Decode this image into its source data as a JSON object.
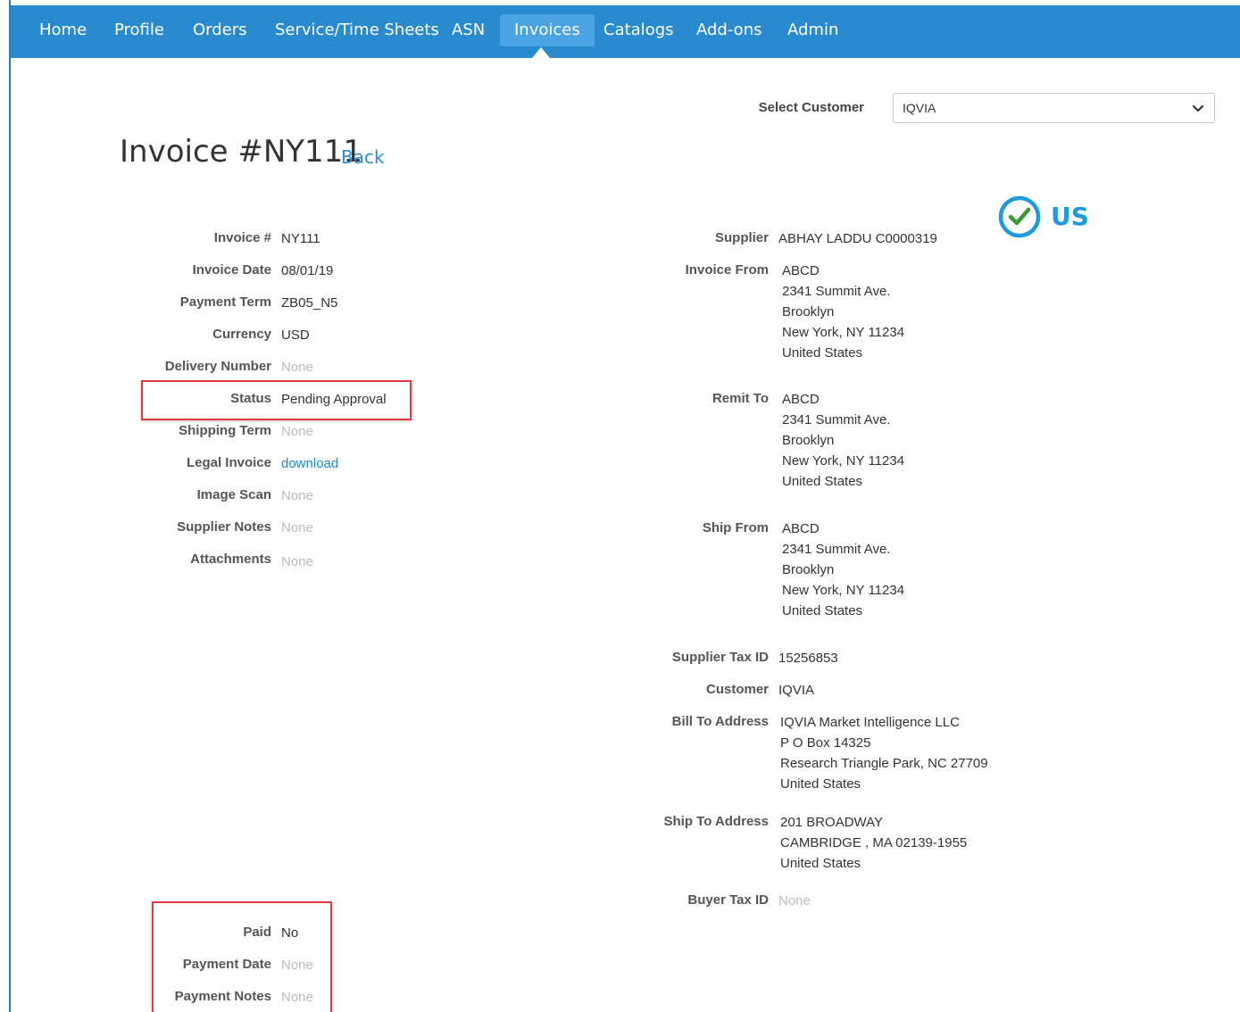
{
  "nav": {
    "items": [
      {
        "label": "Home"
      },
      {
        "label": "Profile"
      },
      {
        "label": "Orders"
      },
      {
        "label": "Service/Time Sheets"
      },
      {
        "label": "ASN"
      },
      {
        "label": "Invoices"
      },
      {
        "label": "Catalogs"
      },
      {
        "label": "Add-ons"
      },
      {
        "label": "Admin"
      }
    ],
    "active": "Invoices"
  },
  "customer_select": {
    "label": "Select Customer",
    "value": "IQVIA"
  },
  "page": {
    "title": "Invoice #NY111",
    "back_label": "Back",
    "country_badge": "US"
  },
  "left_fields": [
    {
      "label": "Invoice #",
      "value": "NY111"
    },
    {
      "label": "Invoice Date",
      "value": "08/01/19"
    },
    {
      "label": "Payment Term",
      "value": "ZB05_N5"
    },
    {
      "label": "Currency",
      "value": "USD"
    },
    {
      "label": "Delivery Number",
      "value": "None"
    },
    {
      "label": "Status",
      "value": "Pending Approval"
    },
    {
      "label": "Shipping Term",
      "value": "None"
    },
    {
      "label": "Legal Invoice",
      "value": "download"
    },
    {
      "label": "Image Scan",
      "value": "None"
    },
    {
      "label": "Supplier Notes",
      "value": "None"
    },
    {
      "label": "Attachments",
      "value": "None"
    }
  ],
  "payment_fields": [
    {
      "label": "Paid",
      "value": "No"
    },
    {
      "label": "Payment Date",
      "value": "None"
    },
    {
      "label": "Payment Notes",
      "value": "None"
    }
  ],
  "right_fields": {
    "supplier": {
      "label": "Supplier",
      "value": "ABHAY LADDU C0000319"
    },
    "invoice_from": {
      "label": "Invoice From",
      "lines": [
        "ABCD",
        "2341 Summit Ave.",
        "Brooklyn",
        "New York, NY 11234",
        "United States"
      ]
    },
    "remit_to": {
      "label": "Remit To",
      "lines": [
        "ABCD",
        "2341 Summit Ave.",
        "Brooklyn",
        "New York, NY 11234",
        "United States"
      ]
    },
    "ship_from": {
      "label": "Ship From",
      "lines": [
        "ABCD",
        "2341 Summit Ave.",
        "Brooklyn",
        "New York, NY 11234",
        "United States"
      ]
    },
    "supplier_tax_id": {
      "label": "Supplier Tax ID",
      "value": "15256853"
    },
    "customer": {
      "label": "Customer",
      "value": "IQVIA"
    },
    "bill_to": {
      "label": "Bill To Address",
      "lines": [
        "IQVIA Market Intelligence LLC",
        "P O Box 14325",
        "Research Triangle Park, NC 27709",
        "United States"
      ]
    },
    "ship_to": {
      "label": "Ship To Address",
      "lines": [
        "201 BROADWAY",
        "CAMBRIDGE , MA 02139-1955",
        "United States"
      ]
    },
    "buyer_tax_id": {
      "label": "Buyer Tax ID",
      "value": "None"
    }
  },
  "colors": {
    "nav_bg": "#2a8ad0",
    "nav_active": "#4aa3e3",
    "link": "#1f86cc",
    "highlight": "#e0393e",
    "badge": "#1e9ae0",
    "check": "#3a9a2e"
  },
  "icons": {
    "dropdown": "chevron-down-icon",
    "badge": "check-circle-icon"
  }
}
